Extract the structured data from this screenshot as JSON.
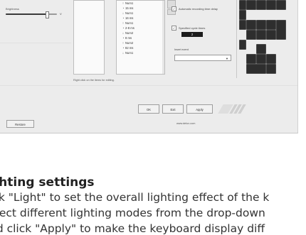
{
  "window": {
    "brightness_label": "Brightness",
    "brightness_level": 0.8,
    "brightness_value": "V"
  },
  "macro_list": {
    "items": [
      {
        "icon": "key-down-icon",
        "glyph": "↑",
        "label": "Num1"
      },
      {
        "icon": "clock-icon",
        "glyph": "◔",
        "label": "15 ms"
      },
      {
        "icon": "key-up-icon",
        "glyph": "↓",
        "label": "Num1"
      },
      {
        "icon": "clock-icon",
        "glyph": "◔",
        "label": "16 ms"
      },
      {
        "icon": "key-down-icon",
        "glyph": "↑",
        "label": "Num1"
      },
      {
        "icon": "clock-icon",
        "glyph": "◔",
        "label": "2-8 ms"
      },
      {
        "icon": "key-up-icon",
        "glyph": "↓",
        "label": "Num2"
      },
      {
        "icon": "clock-icon",
        "glyph": "◔",
        "label": "8 ms"
      },
      {
        "icon": "key-down-icon",
        "glyph": "↑",
        "label": "Num2"
      },
      {
        "icon": "clock-icon",
        "glyph": "◔",
        "label": "82 ms"
      },
      {
        "icon": "key-up-icon",
        "glyph": "↓",
        "label": "Num1"
      }
    ],
    "hint": "Right click on the items for editing."
  },
  "options": {
    "auto_delay_label": "Automatic recording time delay",
    "cycle_label": "Specified cycle times",
    "cycle_value": "2",
    "bind_label": "Insert event",
    "check_mark": "✓"
  },
  "footer": {
    "ok_label": "OK",
    "exit_label": "Exit",
    "apply_label": "Apply",
    "restore_label": "Restore",
    "website": "www.delux.com"
  },
  "text_section": {
    "title": "ghting settings",
    "line1": "ick \"Light\" to set the overall lighting effect of the k",
    "line2": "elect different lighting modes from the drop-down",
    "line3": "nd click \"Apply\" to make the keyboard display diff"
  }
}
